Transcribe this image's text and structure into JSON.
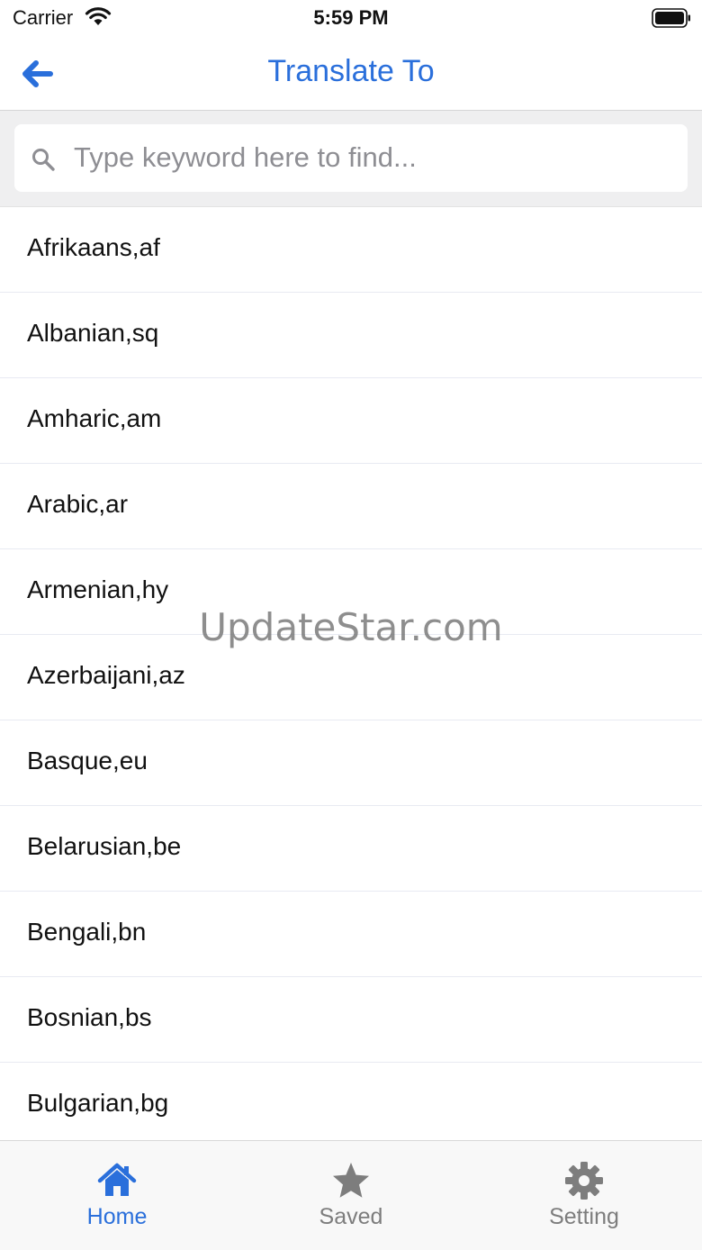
{
  "status_bar": {
    "carrier": "Carrier",
    "time": "5:59 PM"
  },
  "nav": {
    "title": "Translate To",
    "back_icon": "arrow-left-icon"
  },
  "search": {
    "placeholder": "Type keyword here to find...",
    "value": ""
  },
  "languages": [
    "Afrikaans,af",
    "Albanian,sq",
    "Amharic,am",
    "Arabic,ar",
    "Armenian,hy",
    "Azerbaijani,az",
    "Basque,eu",
    "Belarusian,be",
    "Bengali,bn",
    "Bosnian,bs",
    "Bulgarian,bg"
  ],
  "watermark": "UpdateStar.com",
  "tabs": [
    {
      "label": "Home",
      "icon": "home-icon",
      "active": true
    },
    {
      "label": "Saved",
      "icon": "star-icon",
      "active": false
    },
    {
      "label": "Setting",
      "icon": "gear-icon",
      "active": false
    }
  ],
  "colors": {
    "accent": "#2a6fdb",
    "inactive": "#7d7d7d",
    "search_bg": "#efeff0"
  }
}
